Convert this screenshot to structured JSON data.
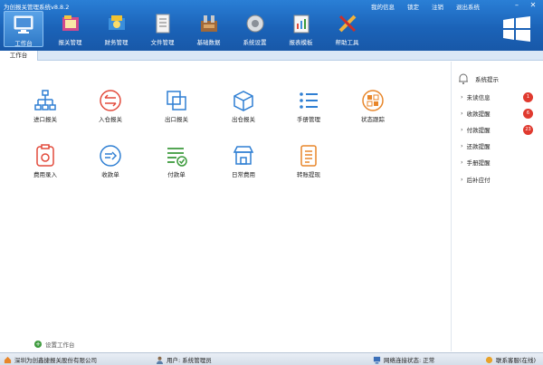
{
  "app": {
    "title": "为创报关管理系统v8.8.2"
  },
  "top_links": [
    "我的信息",
    "锁定",
    "注销",
    "退出系统"
  ],
  "toolbar": [
    {
      "label": "工作台",
      "icon": "monitor-icon",
      "active": true
    },
    {
      "label": "报关管理",
      "icon": "folder-icon"
    },
    {
      "label": "财务管理",
      "icon": "finance-icon"
    },
    {
      "label": "文件管理",
      "icon": "notebook-icon"
    },
    {
      "label": "基础数据",
      "icon": "database-icon"
    },
    {
      "label": "系统设置",
      "icon": "gear-icon"
    },
    {
      "label": "报表模板",
      "icon": "report-icon"
    },
    {
      "label": "帮助工具",
      "icon": "tools-icon"
    }
  ],
  "tab": {
    "label": "工作台"
  },
  "cards": [
    {
      "label": "进口报关",
      "icon": "org-chart-icon",
      "color": "#2f7fd3"
    },
    {
      "label": "入仓报关",
      "icon": "transfer-icon",
      "color": "#e24a3b"
    },
    {
      "label": "出口报关",
      "icon": "export-icon",
      "color": "#2f7fd3"
    },
    {
      "label": "出仓报关",
      "icon": "box-icon",
      "color": "#2f7fd3"
    },
    {
      "label": "手册管理",
      "icon": "list-icon",
      "color": "#2f7fd3"
    },
    {
      "label": "状态跟踪",
      "icon": "status-icon",
      "color": "#e8862a"
    },
    {
      "label": "费用录入",
      "icon": "clipboard-icon",
      "color": "#e24a3b"
    },
    {
      "label": "收款单",
      "icon": "receipt-icon",
      "color": "#2f7fd3"
    },
    {
      "label": "付款单",
      "icon": "payment-icon",
      "color": "#3c9a3c"
    },
    {
      "label": "日常费用",
      "icon": "shop-icon",
      "color": "#2f7fd3"
    },
    {
      "label": "转账提现",
      "icon": "transfer-doc-icon",
      "color": "#e8862a"
    }
  ],
  "add_work": "设置工作台",
  "right_panel": {
    "title": "系统提示",
    "items": [
      {
        "label": "未读信息",
        "badge": "1"
      },
      {
        "label": "收款提醒",
        "badge": "6"
      },
      {
        "label": "付款提醒",
        "badge": "23"
      },
      {
        "label": "还款提醒",
        "badge": ""
      },
      {
        "label": "手册提醒",
        "badge": ""
      },
      {
        "label": "后补应付",
        "badge": ""
      }
    ]
  },
  "status": {
    "company": "深圳为创鑫捷报关股份有限公司",
    "user": "用户: 系统管理员",
    "network": "网络连接状态: 正常",
    "support": "联系客服(在线)"
  }
}
